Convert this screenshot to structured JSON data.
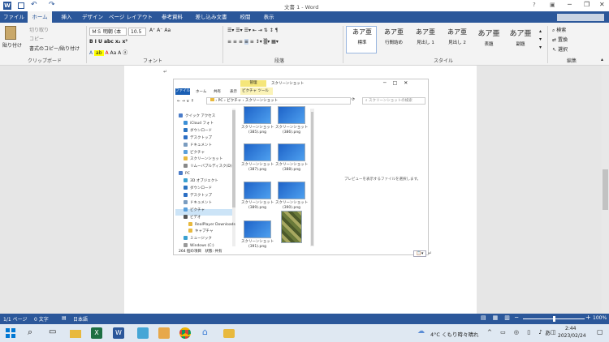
{
  "window": {
    "title": "文書 1 - Word"
  },
  "tabs": [
    "ファイル",
    "ホーム",
    "挿入",
    "デザイン",
    "ページ レイアウト",
    "参考資料",
    "差し込み文書",
    "校閲",
    "表示"
  ],
  "clipboard": {
    "paste": "貼り付け",
    "cut": "切り取り",
    "copy": "コピー",
    "format_painter": "書式のコピー/貼り付け",
    "label": "クリップボード"
  },
  "font": {
    "name": "ＭＳ 明朝 (本",
    "size": "10.5",
    "label": "フォント"
  },
  "paragraph": {
    "label": "段落"
  },
  "styles": {
    "items": [
      {
        "preview": "あア亜",
        "name": "標準"
      },
      {
        "preview": "あア亜",
        "name": "行間詰め"
      },
      {
        "preview": "あア亜",
        "name": "見出し 1"
      },
      {
        "preview": "あア亜",
        "name": "見出し 2"
      },
      {
        "preview": "あア亜",
        "name": "表題"
      },
      {
        "preview": "あア亜",
        "name": "副題"
      }
    ],
    "label": "スタイル"
  },
  "editing": {
    "find": "検索",
    "replace": "置換",
    "select": "選択",
    "label": "編集"
  },
  "explorer": {
    "manage_tab": "管理",
    "folder_title": "スクリーンショット",
    "tabs": [
      "ファイル",
      "ホーム",
      "共有",
      "表示"
    ],
    "picture_tools": "ピクチャ ツール",
    "path": [
      "PC",
      "ピクチャ",
      "スクリーンショット"
    ],
    "search_placeholder": "スクリーンショットの検索",
    "nav": [
      "クイック アクセス",
      "iCloud フォト",
      "ダウンロード",
      "デスクトップ",
      "ドキュメント",
      "ピクチャ",
      "スクリーンショット",
      "リムーバブルディスク(D)",
      "PC",
      "3D オブジェクト",
      "ダウンロード",
      "デスクトップ",
      "ドキュメント",
      "ピクチャ",
      "ビデオ",
      "RealPlayer Downloads",
      "キャプチャ",
      "ミュージック",
      "Windows (C:)"
    ],
    "files": [
      "スクリーンショット\n(385).png",
      "スクリーンショット\n(386).png",
      "スクリーンショット\n(387).png",
      "スクリーンショット\n(388).png",
      "スクリーンショット\n(389).png",
      "スクリーンショット\n(390).png",
      "スクリーンショット\n(391).png",
      ""
    ],
    "preview_msg": "プレビューを表示するファイルを選択します。",
    "status": "264 個の項目　状態: 共有"
  },
  "statusbar": {
    "page": "1/1 ページ",
    "words": "0 文字",
    "lang": "日本語",
    "zoom": "100%"
  },
  "taskbar": {
    "weather": "4°C くもり時々晴れ",
    "time": "2:44",
    "date": "2023/02/24",
    "ime": "あ"
  },
  "colors": {
    "accent": "#2b579a",
    "doc_bg": "#e6e6e6"
  }
}
